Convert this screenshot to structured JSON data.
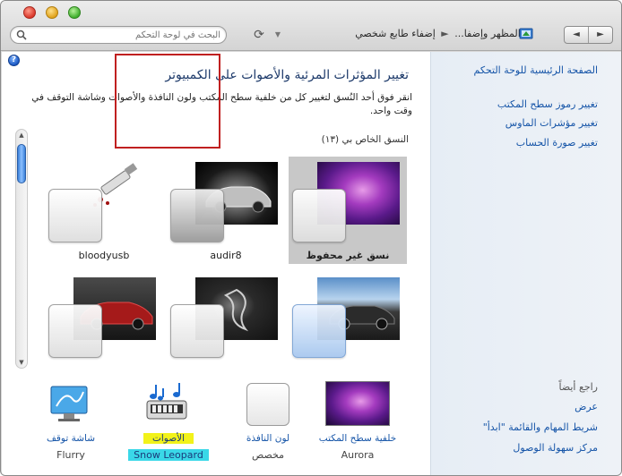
{
  "window": {
    "search_placeholder": "البحث في لوحة التحكم",
    "breadcrumb": [
      "المظهر وإضفا...",
      "إضفاء طابع شخصي"
    ],
    "breadcrumb_prefix": "«",
    "breadcrumb_sep": "►",
    "refresh_glyph": "⟳",
    "dropdown_glyph": "▼",
    "nav_back": "◄",
    "nav_forward": "►",
    "help_glyph": "?"
  },
  "main": {
    "title": "تغيير المؤثرات المرئية والأصوات على الكمبيوتر",
    "description": "انقر فوق أحد النُسق لتغيير كل من خلفية سطح المكتب ولون النافذة والأصوات وشاشة التوقف في وقت واحد.",
    "group_label": "النسق الخاص بي (١٣)",
    "themes": [
      {
        "name": "نسق غير محفوظ",
        "wallpaper": "aurora",
        "selected": true
      },
      {
        "name": "audir8",
        "wallpaper": "car-black",
        "selected": false
      },
      {
        "name": "bloodyusb",
        "wallpaper": "bloody-usb",
        "selected": false
      },
      {
        "name": "",
        "wallpaper": "car-blue",
        "selected": false
      },
      {
        "name": "",
        "wallpaper": "dragon",
        "selected": false
      },
      {
        "name": "",
        "wallpaper": "car-red",
        "selected": false
      }
    ]
  },
  "bottom": {
    "wallpaper": {
      "label": "خلفية سطح المكتب",
      "value": "Aurora"
    },
    "color": {
      "label": "لون النافذة",
      "value": "مخصص"
    },
    "sounds": {
      "label": "الأصوات",
      "value": "Snow Leopard"
    },
    "screensaver": {
      "label": "شاشة توقف",
      "value": "Flurry"
    }
  },
  "sidebar": {
    "home": "الصفحة الرئيسية للوحة التحكم",
    "links": [
      "تغيير رموز سطح المكتب",
      "تغيير مؤشرات الماوس",
      "تغيير صورة الحساب"
    ],
    "see_also_heading": "راجع أيضاً",
    "see_also": [
      "عرض",
      "شريط المهام والقائمة \"ابدأ\"",
      "مركز سهولة الوصول"
    ]
  },
  "colors": {
    "link": "#1655a8",
    "title": "#1d3a6a",
    "highlight_yellow": "#f2f21a",
    "highlight_cyan": "#3ad8e8",
    "selection_box": "#c02020"
  }
}
